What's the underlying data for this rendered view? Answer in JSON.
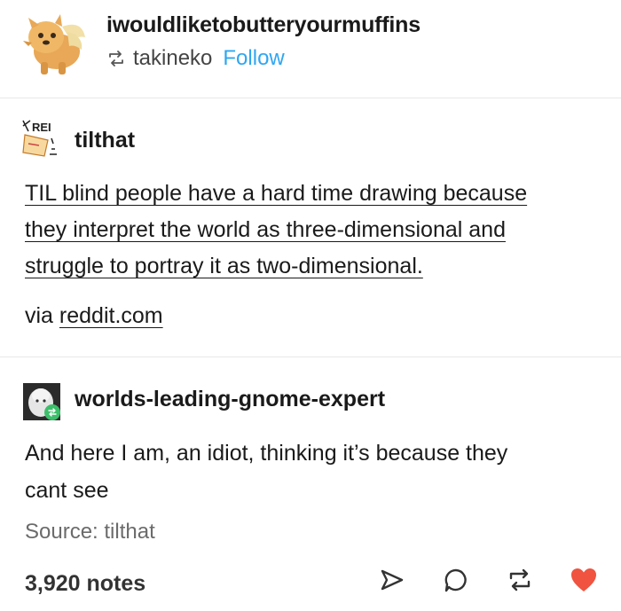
{
  "post": {
    "blog_name": "iwouldliketobutteryourmuffins",
    "reblogged_from": "takineko",
    "follow_label": "Follow"
  },
  "til": {
    "name": "tilthat",
    "avatar_text": "REI",
    "text_line1": "TIL blind people have a hard time drawing because",
    "text_line2": "they interpret the world as three-dimensional and",
    "text_line3": "struggle to portray it as two-dimensional.",
    "via_prefix": "via",
    "via_link": "reddit.com"
  },
  "gnome": {
    "name": "worlds-leading-gnome-expert",
    "text_line1": "And here I am, an idiot, thinking it’s because they",
    "text_line2": "cant see",
    "source": "Source: tilthat"
  },
  "footer": {
    "notes": "3,920 notes",
    "icons": [
      "share-icon",
      "reply-icon",
      "reblog-icon",
      "like-icon"
    ],
    "like_color": "#f0533f",
    "icon_color": "#333333"
  },
  "colors": {
    "follow": "#2fa6f0",
    "text": "#1a1a1a",
    "source": "#6b6b6b"
  }
}
